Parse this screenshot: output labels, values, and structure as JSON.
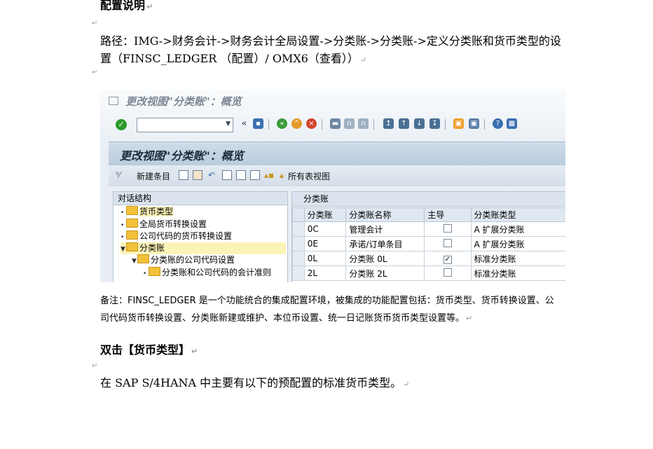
{
  "heading1": "配置说明",
  "path_text": "路径：IMG->财务会计->财务会计全局设置->分类账->分类账->定义分类账和货币类型的设置（FINSC_LEDGER （配置）/ OMX6（查看））",
  "paragraph_mark": "↵",
  "sap": {
    "window_title": "更改视图\"分类账\"：概览",
    "page_title": "更改视图\"分类账\"：概览",
    "new_entry_label": "新建条目",
    "all_tables_label": "所有表视图",
    "tree_header": "对话结构",
    "tree": [
      {
        "label": "货币类型",
        "level": 0,
        "selected": true
      },
      {
        "label": "全局货币转换设置",
        "level": 0,
        "selected": false
      },
      {
        "label": "公司代码的货币转换设置",
        "level": 0,
        "selected": false
      },
      {
        "label": "分类账",
        "level": 0,
        "selected": true
      },
      {
        "label": "分类账的公司代码设置",
        "level": 1,
        "selected": false
      },
      {
        "label": "分类账和公司代码的会计准则",
        "level": 2,
        "selected": false
      }
    ],
    "table_title": "分类账",
    "columns": [
      "分类账",
      "分类账名称",
      "主导",
      "分类账类型"
    ],
    "rows": [
      {
        "id": "0C",
        "name": "管理会计",
        "leading": false,
        "type": "A 扩展分类账"
      },
      {
        "id": "0E",
        "name": "承诺/订单条目",
        "leading": false,
        "type": "A 扩展分类账"
      },
      {
        "id": "0L",
        "name": "分类账 0L",
        "leading": true,
        "type": "标准分类账"
      },
      {
        "id": "2L",
        "name": "分类账 2L",
        "leading": false,
        "type": "标准分类账"
      }
    ]
  },
  "note": "备注：FINSC_LEDGER 是一个功能统合的集成配置环境，被集成的功能配置包括：货币类型、货币转换设置、公司代码货币转换设置、分类账新建或维护、本位币设置、统一日记账货币货币类型设置等。",
  "heading2": "双击【货币类型】",
  "paragraph": "在 SAP S/4HANA 中主要有以下的预配置的标准货币类型。"
}
